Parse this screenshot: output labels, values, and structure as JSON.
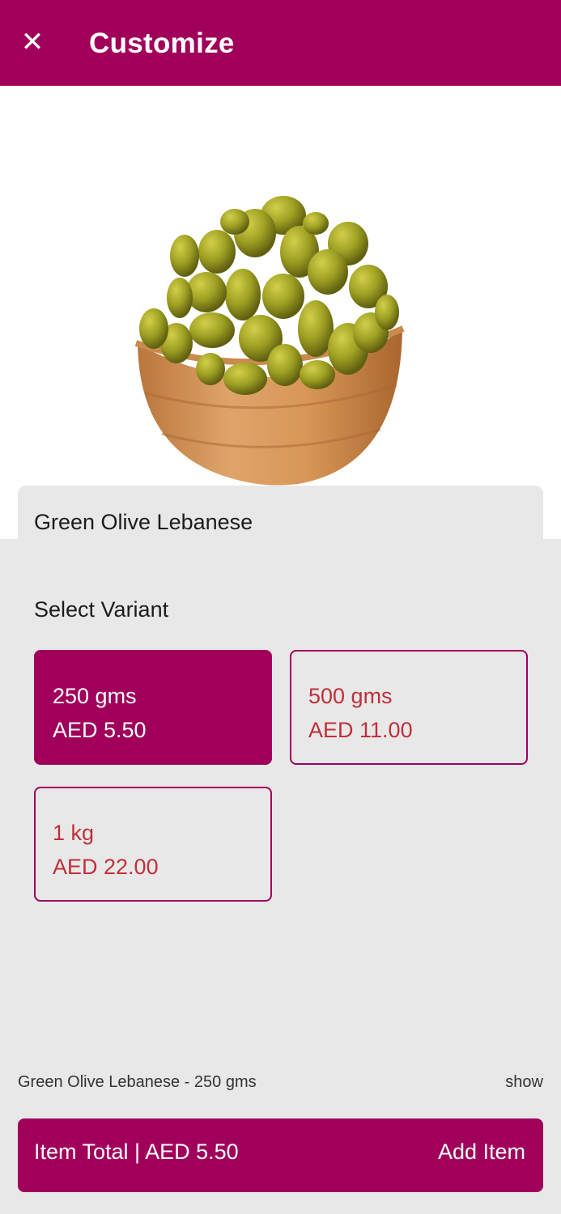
{
  "header": {
    "title": "Customize",
    "close_icon": "close-icon"
  },
  "product": {
    "name": "Green Olive Lebanese",
    "image": "green-olives-in-wooden-bowl"
  },
  "variants": {
    "section_label": "Select Variant",
    "items": [
      {
        "name": "250 gms",
        "price": "AED 5.50",
        "selected": true
      },
      {
        "name": "500 gms",
        "price": "AED 11.00",
        "selected": false
      },
      {
        "name": "1 kg",
        "price": "AED 22.00",
        "selected": false
      }
    ]
  },
  "footer": {
    "summary": "Green Olive Lebanese - 250 gms",
    "show_label": "show",
    "item_total": "Item Total | AED 5.50",
    "add_label": "Add Item"
  },
  "colors": {
    "brand": "#a0005a",
    "unselected_text": "#c0303a",
    "background": "#e8e8e8"
  }
}
